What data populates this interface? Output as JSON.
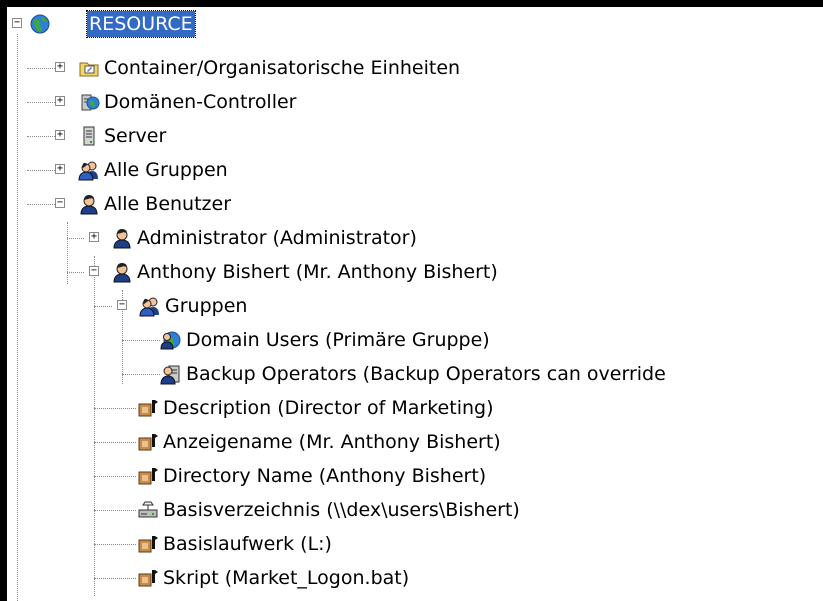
{
  "tree": {
    "root": {
      "label": "RESOURCE",
      "icon": "globe-icon",
      "expander": "−"
    },
    "top_nodes": [
      {
        "label": "Container/Organisatorische Einheiten",
        "icon": "container-folder-icon",
        "expander": "+"
      },
      {
        "label": "Domänen-Controller",
        "icon": "domain-controller-icon",
        "expander": "+"
      },
      {
        "label": "Server",
        "icon": "server-icon",
        "expander": "+"
      },
      {
        "label": "Alle Gruppen",
        "icon": "group-icon",
        "expander": "+"
      },
      {
        "label": "Alle Benutzer",
        "icon": "user-icon",
        "expander": "−"
      }
    ],
    "users": [
      {
        "label": "Administrator (Administrator)",
        "icon": "user-icon",
        "expander": "+"
      },
      {
        "label": "Anthony Bishert (Mr. Anthony Bishert)",
        "icon": "user-icon",
        "expander": "−"
      }
    ],
    "groups_node": {
      "label": "Gruppen",
      "icon": "group-icon",
      "expander": "−"
    },
    "groups": [
      {
        "label": "Domain Users (Primäre Gruppe)",
        "icon": "domain-group-icon"
      },
      {
        "label": "Backup Operators (Backup Operators can override",
        "icon": "backup-group-icon"
      }
    ],
    "attributes": [
      {
        "label": "Description (Director of Marketing)",
        "icon": "attribute-icon"
      },
      {
        "label": "Anzeigename (Mr. Anthony Bishert)",
        "icon": "attribute-icon"
      },
      {
        "label": "Directory Name (Anthony Bishert)",
        "icon": "attribute-icon"
      },
      {
        "label": "Basisverzeichnis (\\\\dex\\users\\Bishert)",
        "icon": "drive-icon"
      },
      {
        "label": "Basislaufwerk (L:)",
        "icon": "attribute-icon"
      },
      {
        "label": "Skript (Market_Logon.bat)",
        "icon": "attribute-icon"
      }
    ]
  },
  "colors": {
    "selection": "#316ac5",
    "connector": "#8a8a8a",
    "frame": "#000000"
  }
}
